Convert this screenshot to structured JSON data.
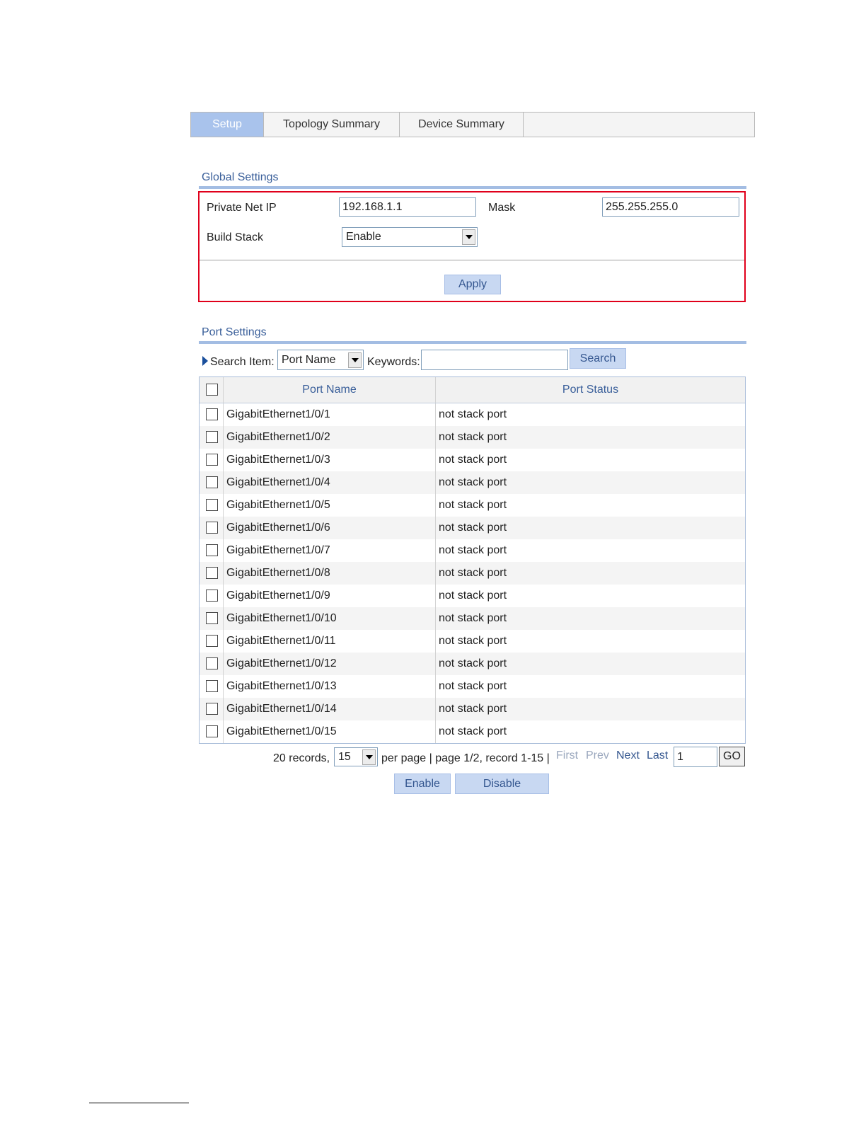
{
  "tabs": [
    {
      "label": "Setup",
      "active": true
    },
    {
      "label": "Topology Summary",
      "active": false
    },
    {
      "label": "Device Summary",
      "active": false
    }
  ],
  "global_settings": {
    "title": "Global Settings",
    "private_net_ip_label": "Private Net IP",
    "private_net_ip_value": "192.168.1.1",
    "mask_label": "Mask",
    "mask_value": "255.255.255.0",
    "build_stack_label": "Build Stack",
    "build_stack_value": "Enable",
    "apply_label": "Apply",
    "highlight_color": "#e0001b"
  },
  "port_settings": {
    "title": "Port Settings",
    "search_item_label": "Search Item:",
    "search_item_value": "Port Name",
    "keywords_label": "Keywords:",
    "keywords_value": "",
    "search_button": "Search",
    "columns": [
      "Port Name",
      "Port Status"
    ],
    "rows": [
      {
        "name": "GigabitEthernet1/0/1",
        "status": "not stack port"
      },
      {
        "name": "GigabitEthernet1/0/2",
        "status": "not stack port"
      },
      {
        "name": "GigabitEthernet1/0/3",
        "status": "not stack port"
      },
      {
        "name": "GigabitEthernet1/0/4",
        "status": "not stack port"
      },
      {
        "name": "GigabitEthernet1/0/5",
        "status": "not stack port"
      },
      {
        "name": "GigabitEthernet1/0/6",
        "status": "not stack port"
      },
      {
        "name": "GigabitEthernet1/0/7",
        "status": "not stack port"
      },
      {
        "name": "GigabitEthernet1/0/8",
        "status": "not stack port"
      },
      {
        "name": "GigabitEthernet1/0/9",
        "status": "not stack port"
      },
      {
        "name": "GigabitEthernet1/0/10",
        "status": "not stack port"
      },
      {
        "name": "GigabitEthernet1/0/11",
        "status": "not stack port"
      },
      {
        "name": "GigabitEthernet1/0/12",
        "status": "not stack port"
      },
      {
        "name": "GigabitEthernet1/0/13",
        "status": "not stack port"
      },
      {
        "name": "GigabitEthernet1/0/14",
        "status": "not stack port"
      },
      {
        "name": "GigabitEthernet1/0/15",
        "status": "not stack port"
      }
    ],
    "pagination": {
      "records_text": "20 records,",
      "per_page_value": "15",
      "page_info": "per page | page 1/2, record 1-15 |",
      "first": "First",
      "prev": "Prev",
      "next": "Next",
      "last": "Last",
      "page_input": "1",
      "go": "GO"
    },
    "enable_button": "Enable",
    "disable_button": "Disable"
  }
}
